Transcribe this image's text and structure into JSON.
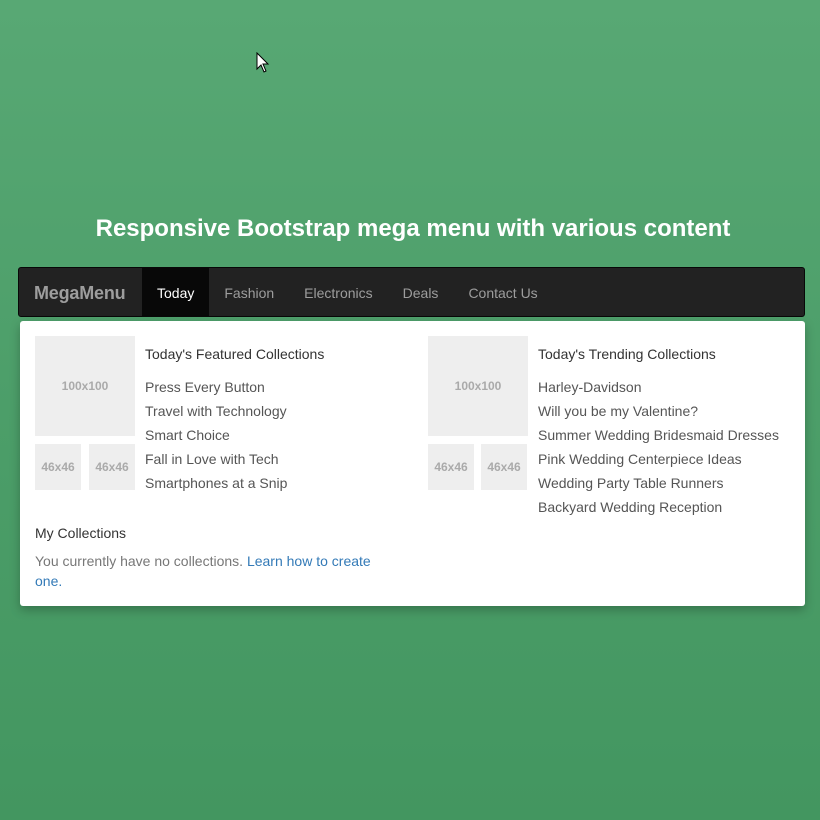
{
  "page": {
    "title": "Responsive Bootstrap mega menu with various content"
  },
  "navbar": {
    "brand": "MegaMenu",
    "items": [
      {
        "label": "Today",
        "active": true
      },
      {
        "label": "Fashion",
        "active": false
      },
      {
        "label": "Electronics",
        "active": false
      },
      {
        "label": "Deals",
        "active": false
      },
      {
        "label": "Contact Us",
        "active": false
      }
    ]
  },
  "dropdown": {
    "featured": {
      "title": "Today's Featured Collections",
      "main_image": "100x100",
      "thumbs": [
        "46x46",
        "46x46"
      ],
      "links": [
        "Press Every Button",
        "Travel with Technology",
        "Smart Choice",
        "Fall in Love with Tech",
        "Smartphones at a Snip"
      ]
    },
    "trending": {
      "title": "Today's Trending Collections",
      "main_image": "100x100",
      "thumbs": [
        "46x46",
        "46x46"
      ],
      "links": [
        "Harley-Davidson",
        "Will you be my Valentine?",
        "Summer Wedding Bridesmaid Dresses",
        "Pink Wedding Centerpiece Ideas",
        "Wedding Party Table Runners",
        "Backyard Wedding Reception"
      ]
    },
    "my_collections": {
      "title": "My Collections",
      "text": "You currently have no collections.",
      "link": "Learn how to create one."
    }
  },
  "colors": {
    "background": "#4c9e69",
    "navbar": "#222222",
    "active_tab": "#080808",
    "link": "#337ab7"
  }
}
